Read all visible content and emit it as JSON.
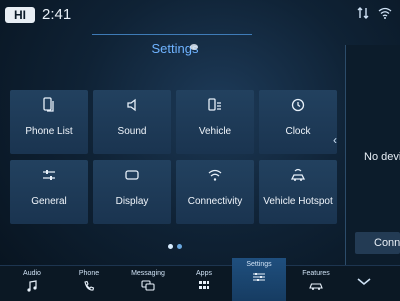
{
  "status": {
    "user_badge": "HI",
    "time": "2:41",
    "icons": [
      "data-arrows-icon",
      "wifi-icon"
    ]
  },
  "header": {
    "title": "Settings"
  },
  "tiles": [
    {
      "label": "Phone List",
      "icon": "phone-list-icon"
    },
    {
      "label": "Sound",
      "icon": "speaker-icon"
    },
    {
      "label": "Vehicle",
      "icon": "vehicle-icon"
    },
    {
      "label": "Clock",
      "icon": "clock-icon"
    },
    {
      "label": "General",
      "icon": "sliders-icon"
    },
    {
      "label": "Display",
      "icon": "display-icon"
    },
    {
      "label": "Connectivity",
      "icon": "wifi-icon"
    },
    {
      "label": "Vehicle Hotspot",
      "icon": "hotspot-icon"
    }
  ],
  "pager": {
    "pages": 2,
    "active": 1
  },
  "right_panel": {
    "message": "No devic",
    "button_label": "Conn"
  },
  "nav": {
    "items": [
      {
        "label": "Audio",
        "icon": "music-note-icon"
      },
      {
        "label": "Phone",
        "icon": "phone-icon"
      },
      {
        "label": "Messaging",
        "icon": "chat-icon"
      },
      {
        "label": "Apps",
        "icon": "apps-grid-icon"
      },
      {
        "label": "Settings",
        "icon": "settings-sliders-icon"
      },
      {
        "label": "Features",
        "icon": "car-features-icon"
      }
    ],
    "active": "Settings"
  },
  "colors": {
    "accent": "#6fb3ff",
    "tile_bg": "#1f3c59",
    "background": "#0b1825"
  }
}
